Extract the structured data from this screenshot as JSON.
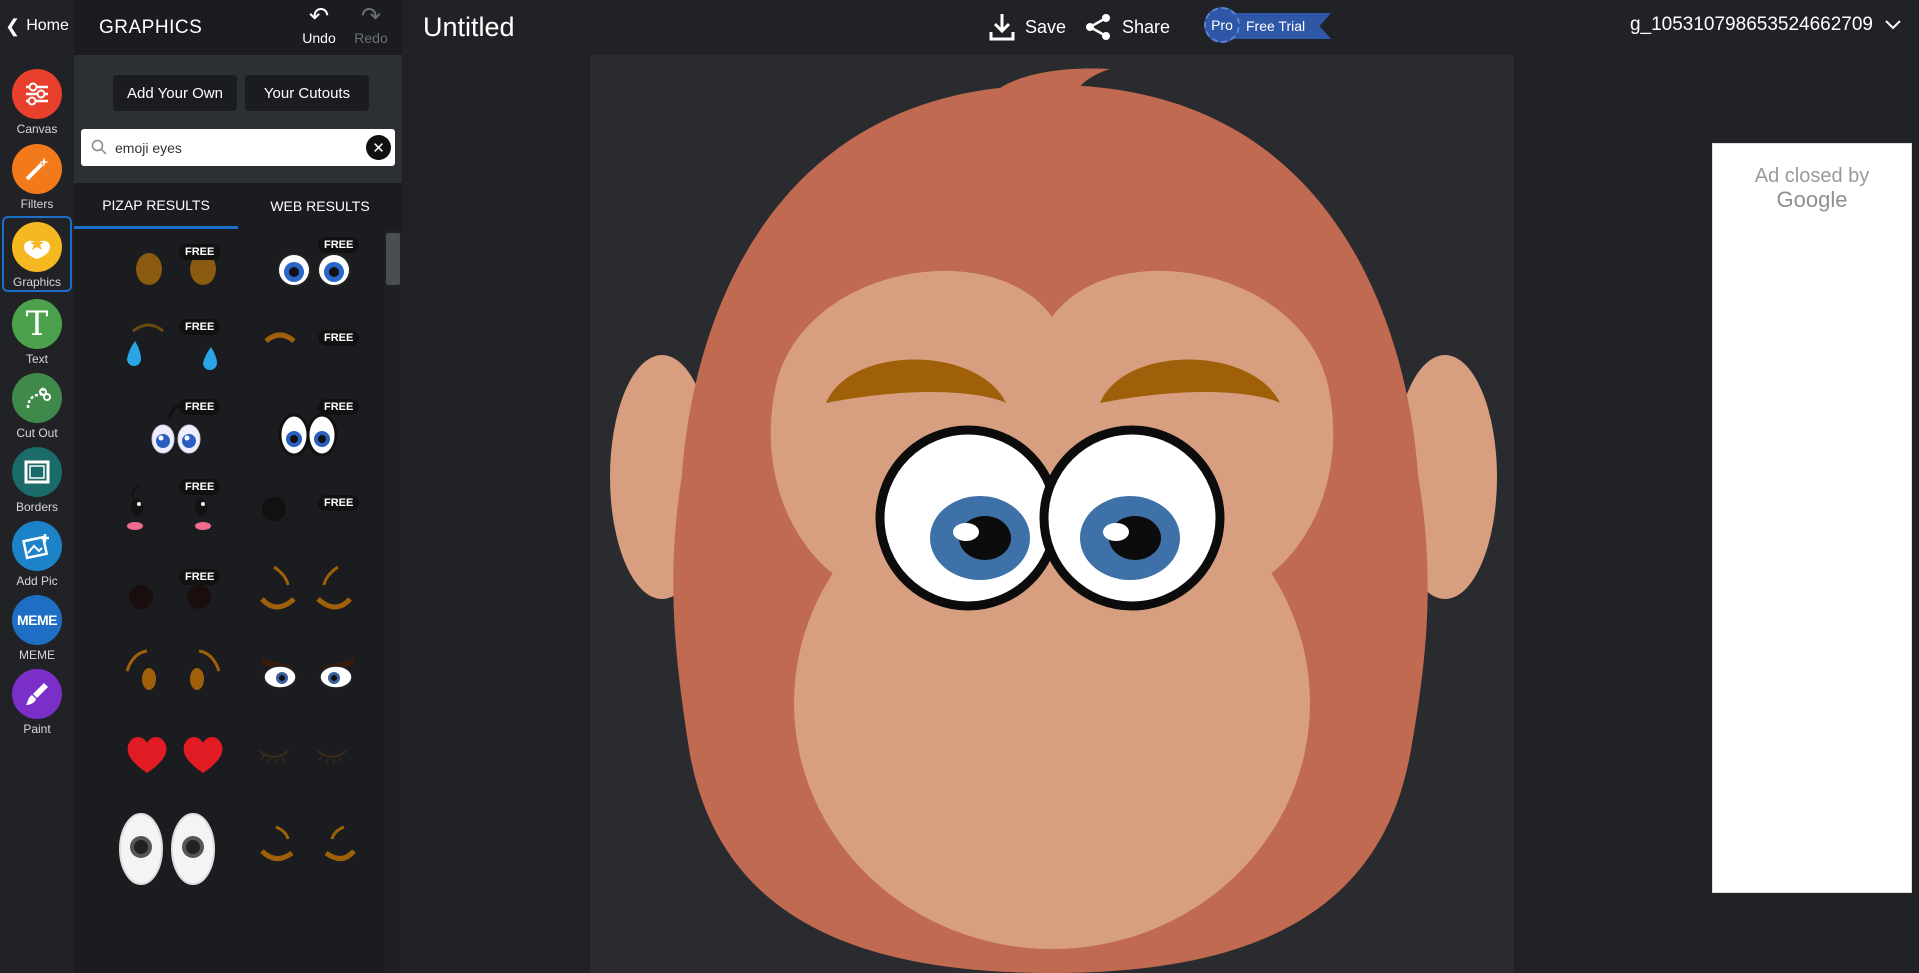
{
  "header": {
    "home_label": "Home",
    "panel_title": "GRAPHICS",
    "undo_label": "Undo",
    "redo_label": "Redo",
    "document_title": "Untitled",
    "save_label": "Save",
    "share_label": "Share",
    "pro_label": "Pro",
    "free_trial_label": "Free Trial",
    "username": "g_105310798653524662709"
  },
  "rail": {
    "tools": [
      {
        "label": "Canvas",
        "color": "#e8402c",
        "icon": "sliders-icon"
      },
      {
        "label": "Filters",
        "color": "#f27a1a",
        "icon": "magic-wand-icon"
      },
      {
        "label": "Graphics",
        "color": "#f5b820",
        "icon": "sticker-icon"
      },
      {
        "label": "Text",
        "color": "#4da14d",
        "icon": "text-icon"
      },
      {
        "label": "Cut Out",
        "color": "#3f8a4a",
        "icon": "cutout-icon"
      },
      {
        "label": "Borders",
        "color": "#1c6b6b",
        "icon": "border-icon"
      },
      {
        "label": "Add Pic",
        "color": "#1d83c9",
        "icon": "add-picture-icon"
      },
      {
        "label": "MEME",
        "color": "#1e6fc4",
        "icon": "meme-icon"
      },
      {
        "label": "Paint",
        "color": "#7a2fc9",
        "icon": "paintbrush-icon"
      }
    ]
  },
  "panel": {
    "add_your_own_label": "Add Your Own",
    "your_cutouts_label": "Your Cutouts",
    "search_value": "emoji eyes",
    "tab_pizap": "PIZAP RESULTS",
    "tab_web": "WEB RESULTS",
    "free_badge": "FREE"
  },
  "ad": {
    "line1": "Ad closed by",
    "line2": "Google"
  }
}
